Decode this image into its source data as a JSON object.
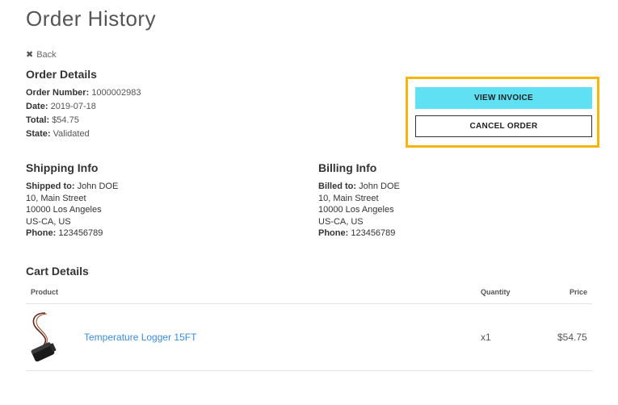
{
  "page": {
    "title": "Order History"
  },
  "nav": {
    "back_label": "Back"
  },
  "order_details": {
    "title": "Order Details",
    "number_label": "Order Number:",
    "number_value": "1000002983",
    "date_label": "Date:",
    "date_value": "2019-07-18",
    "total_label": "Total:",
    "total_value": "$54.75",
    "state_label": "State:",
    "state_value": "Validated"
  },
  "actions": {
    "view_invoice": "VIEW INVOICE",
    "cancel_order": "CANCEL ORDER",
    "highlight_color": "#f5b50a",
    "invoice_color": "#5fe0f3"
  },
  "shipping": {
    "title": "Shipping Info",
    "to_label": "Shipped to:",
    "name": "John DOE",
    "street": "10, Main Street",
    "city": "10000 Los Angeles",
    "region": "US-CA, US",
    "phone_label": "Phone:",
    "phone": "123456789"
  },
  "billing": {
    "title": "Billing Info",
    "to_label": "Billed to:",
    "name": "John DOE",
    "street": "10, Main Street",
    "city": "10000 Los Angeles",
    "region": "US-CA, US",
    "phone_label": "Phone:",
    "phone": "123456789"
  },
  "cart": {
    "title": "Cart Details",
    "columns": {
      "product": "Product",
      "quantity": "Quantity",
      "price": "Price"
    },
    "items": [
      {
        "name": "Temperature Logger 15FT",
        "quantity": "x1",
        "price": "$54.75"
      }
    ]
  }
}
